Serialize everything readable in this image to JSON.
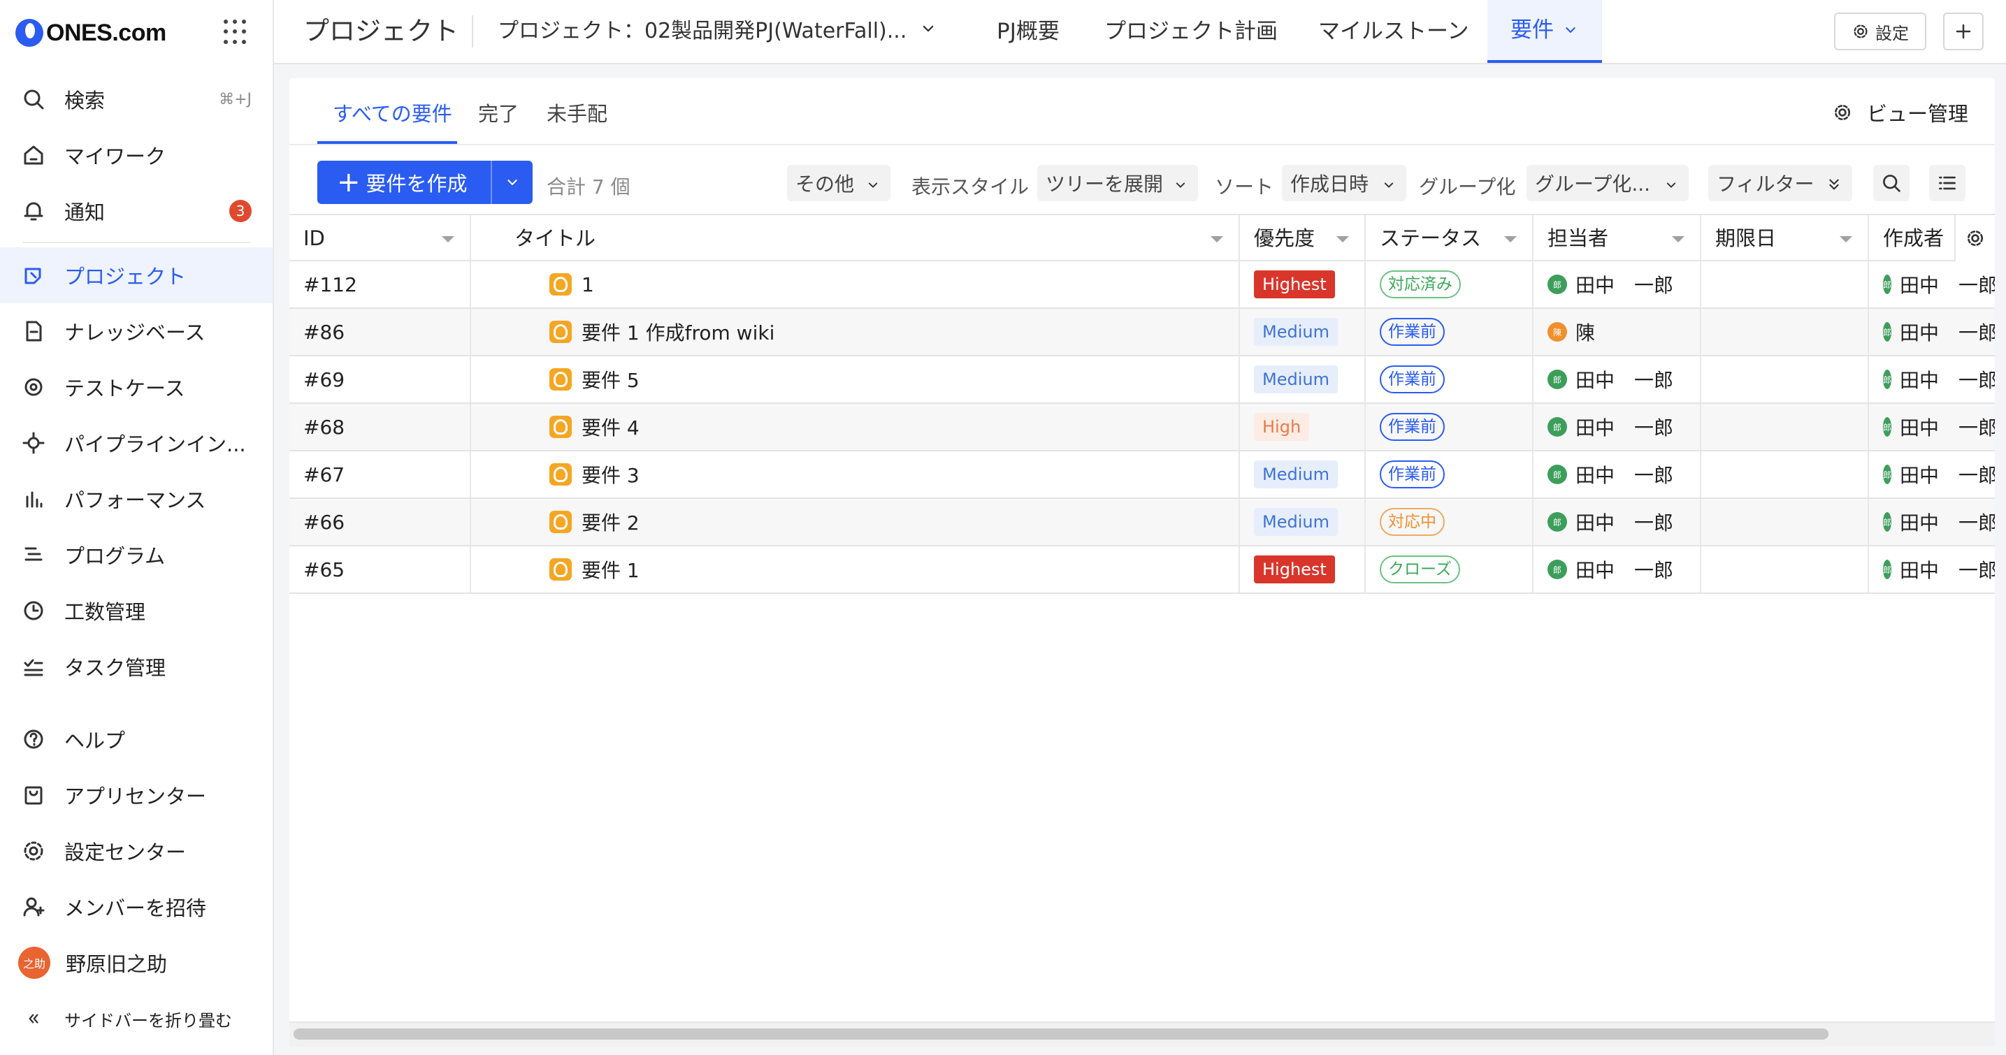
{
  "app": {
    "logo_text": "ONES.com"
  },
  "sidebar": {
    "items": [
      {
        "label": "検索",
        "shortcut": "⌘+J",
        "icon": "search-icon"
      },
      {
        "label": "マイワーク",
        "icon": "home-icon"
      },
      {
        "label": "通知",
        "badge": "3",
        "icon": "bell-icon"
      },
      {
        "label": "プロジェクト",
        "icon": "project-icon",
        "active": true
      },
      {
        "label": "ナレッジベース",
        "icon": "wiki-icon"
      },
      {
        "label": "テストケース",
        "icon": "testcase-icon"
      },
      {
        "label": "パイプラインイン...",
        "icon": "pipeline-icon"
      },
      {
        "label": "パフォーマンス",
        "icon": "performance-icon"
      },
      {
        "label": "プログラム",
        "icon": "program-icon"
      },
      {
        "label": "工数管理",
        "icon": "clock-icon"
      },
      {
        "label": "タスク管理",
        "icon": "task-icon"
      },
      {
        "label": "ヘルプ",
        "icon": "help-icon"
      },
      {
        "label": "アプリセンター",
        "icon": "app-center-icon"
      },
      {
        "label": "設定センター",
        "icon": "gear-icon"
      },
      {
        "label": "メンバーを招待",
        "icon": "invite-user-icon"
      }
    ],
    "user": {
      "name": "野原旧之助",
      "avatar_text": "之助"
    },
    "collapse_label": "サイドバーを折り畳む"
  },
  "header": {
    "title": "プロジェクト",
    "project_selector": "プロジェクト：02製品開発PJ(WaterFall)...",
    "tabs": [
      {
        "label": "PJ概要"
      },
      {
        "label": "プロジェクト計画"
      },
      {
        "label": "マイルストーン"
      },
      {
        "label": "要件",
        "active": true
      }
    ],
    "settings_label": "設定"
  },
  "main": {
    "subtabs": [
      {
        "label": "すべての要件",
        "active": true
      },
      {
        "label": "完了"
      },
      {
        "label": "未手配"
      }
    ],
    "view_management_label": "ビュー管理",
    "toolbar": {
      "create_label": "要件を作成",
      "total_label": "合計 7 個",
      "other_label": "その他",
      "display_style_label": "表示スタイル",
      "display_style_value": "ツリーを展開",
      "sort_label": "ソート",
      "sort_value": "作成日時",
      "group_label": "グループ化",
      "group_value": "グループ化...",
      "filter_label": "フィルター"
    },
    "table": {
      "columns": [
        "ID",
        "タイトル",
        "優先度",
        "ステータス",
        "担当者",
        "期限日",
        "作成者"
      ],
      "rows": [
        {
          "id": "#112",
          "title": "1",
          "priority": "Highest",
          "priority_kind": "highest",
          "status": "対応済み",
          "status_kind": "done",
          "assignee": "田中　一郎",
          "assignee_avatar": "郎",
          "due": "",
          "creator": "田中　一郎",
          "creator_avatar": "郎"
        },
        {
          "id": "#86",
          "title": "要件 1 作成from wiki",
          "priority": "Medium",
          "priority_kind": "medium",
          "status": "作業前",
          "status_kind": "todo",
          "assignee": "陳",
          "assignee_avatar": "陳",
          "due": "",
          "creator": "田中　一郎",
          "creator_avatar": "郎"
        },
        {
          "id": "#69",
          "title": "要件 5",
          "priority": "Medium",
          "priority_kind": "medium",
          "status": "作業前",
          "status_kind": "todo",
          "assignee": "田中　一郎",
          "assignee_avatar": "郎",
          "due": "",
          "creator": "田中　一郎",
          "creator_avatar": "郎"
        },
        {
          "id": "#68",
          "title": "要件 4",
          "priority": "High",
          "priority_kind": "high",
          "status": "作業前",
          "status_kind": "todo",
          "assignee": "田中　一郎",
          "assignee_avatar": "郎",
          "due": "",
          "creator": "田中　一郎",
          "creator_avatar": "郎"
        },
        {
          "id": "#67",
          "title": "要件 3",
          "priority": "Medium",
          "priority_kind": "medium",
          "status": "作業前",
          "status_kind": "todo",
          "assignee": "田中　一郎",
          "assignee_avatar": "郎",
          "due": "",
          "creator": "田中　一郎",
          "creator_avatar": "郎"
        },
        {
          "id": "#66",
          "title": "要件 2",
          "priority": "Medium",
          "priority_kind": "medium",
          "status": "対応中",
          "status_kind": "inprog",
          "assignee": "田中　一郎",
          "assignee_avatar": "郎",
          "due": "",
          "creator": "田中　一郎",
          "creator_avatar": "郎"
        },
        {
          "id": "#65",
          "title": "要件 1",
          "priority": "Highest",
          "priority_kind": "highest",
          "status": "クローズ",
          "status_kind": "closed",
          "assignee": "田中　一郎",
          "assignee_avatar": "郎",
          "due": "",
          "creator": "田中　一郎",
          "creator_avatar": "郎"
        }
      ]
    }
  },
  "colors": {
    "accent": "#2a5cf2",
    "highest": "#d9352b",
    "badge": "#e0492e",
    "requirement_icon": "#f5a623"
  }
}
